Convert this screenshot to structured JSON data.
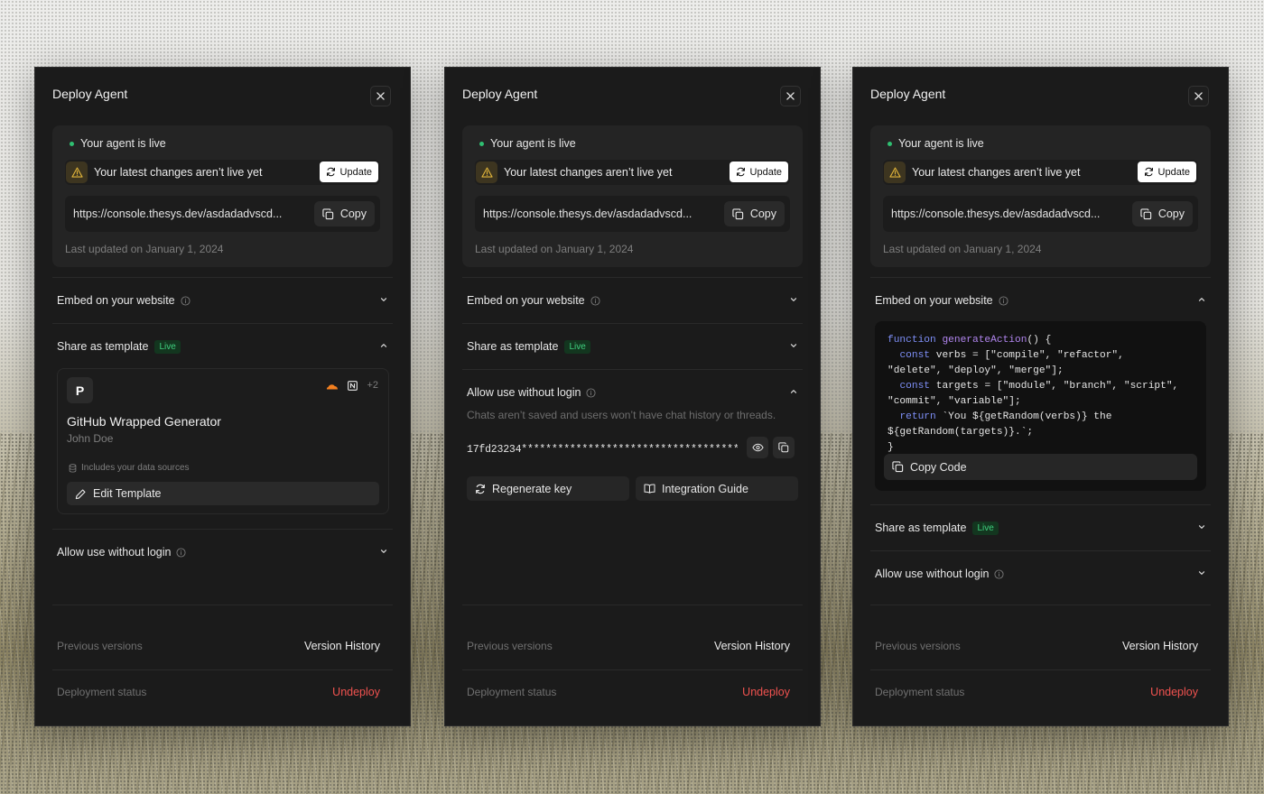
{
  "panels": [
    {
      "title": "Deploy Agent",
      "status": {
        "live_text": "Your agent is live",
        "warning_text": "Your latest changes aren’t live yet",
        "update_label": "Update",
        "url": "https://console.thesys.dev/asdadadvscd...",
        "copy_label": "Copy",
        "last_updated": "Last updated on January 1, 2024"
      },
      "sections": {
        "embed": {
          "label": "Embed on your website",
          "expanded": false
        },
        "share": {
          "label": "Share as template",
          "badge": "Live",
          "expanded": true
        },
        "allow": {
          "label": "Allow use without login",
          "expanded": false
        }
      },
      "template": {
        "avatar_letter": "P",
        "extra_count": "+2",
        "name": "GitHub Wrapped Generator",
        "author": "John Doe",
        "note": "Includes your data sources",
        "edit_label": "Edit Template"
      },
      "footer": {
        "prev_label": "Previous versions",
        "prev_action": "Version History",
        "status_label": "Deployment status",
        "status_action": "Undeploy"
      }
    },
    {
      "title": "Deploy Agent",
      "status": {
        "live_text": "Your agent is live",
        "warning_text": "Your latest changes aren’t live yet",
        "update_label": "Update",
        "url": "https://console.thesys.dev/asdadadvscd...",
        "copy_label": "Copy",
        "last_updated": "Last updated on January 1, 2024"
      },
      "sections": {
        "embed": {
          "label": "Embed on your website",
          "expanded": false
        },
        "share": {
          "label": "Share as template",
          "badge": "Live",
          "expanded": false
        },
        "allow": {
          "label": "Allow use without login",
          "expanded": true
        }
      },
      "allow_panel": {
        "description": "Chats aren’t saved and users won’t have chat history or threads.",
        "key": "17fd23234***************************************...",
        "regenerate_label": "Regenerate key",
        "guide_label": "Integration Guide"
      },
      "footer": {
        "prev_label": "Previous versions",
        "prev_action": "Version History",
        "status_label": "Deployment status",
        "status_action": "Undeploy"
      }
    },
    {
      "title": "Deploy Agent",
      "status": {
        "live_text": "Your agent is live",
        "warning_text": "Your latest changes aren’t live yet",
        "update_label": "Update",
        "url": "https://console.thesys.dev/asdadadvscd...",
        "copy_label": "Copy",
        "last_updated": "Last updated on January 1, 2024"
      },
      "sections": {
        "embed": {
          "label": "Embed on your website",
          "expanded": true
        },
        "share": {
          "label": "Share as template",
          "badge": "Live",
          "expanded": false
        },
        "allow": {
          "label": "Allow use without login",
          "expanded": false
        }
      },
      "embed_panel": {
        "code_lines": [
          [
            {
              "t": "function ",
              "c": "kw"
            },
            {
              "t": "generateAction",
              "c": "fn"
            },
            {
              "t": "() {",
              "c": ""
            }
          ],
          [
            {
              "t": "  ",
              "c": ""
            },
            {
              "t": "const",
              "c": "kw"
            },
            {
              "t": " verbs = [\"compile\", \"refactor\",",
              "c": ""
            }
          ],
          [
            {
              "t": "\"delete\", \"deploy\", \"merge\"];",
              "c": ""
            }
          ],
          [
            {
              "t": "  ",
              "c": ""
            },
            {
              "t": "const",
              "c": "kw"
            },
            {
              "t": " targets = [\"module\", \"branch\", \"script\",",
              "c": ""
            }
          ],
          [
            {
              "t": "\"commit\", \"variable\"];",
              "c": ""
            }
          ],
          [
            {
              "t": "  ",
              "c": ""
            },
            {
              "t": "return",
              "c": "kw"
            },
            {
              "t": " `You ${getRandom(verbs)} the",
              "c": ""
            }
          ],
          [
            {
              "t": "${getRandom(targets)}.`;",
              "c": ""
            }
          ],
          [
            {
              "t": "}",
              "c": ""
            }
          ]
        ],
        "copy_code_label": "Copy Code"
      },
      "footer": {
        "prev_label": "Previous versions",
        "prev_action": "Version History",
        "status_label": "Deployment status",
        "status_action": "Undeploy"
      }
    }
  ],
  "colors": {
    "panel_bg": "#1b1b1b",
    "live_green": "#2fbf71",
    "danger": "#f0524f",
    "warning": "#e0b43a"
  }
}
